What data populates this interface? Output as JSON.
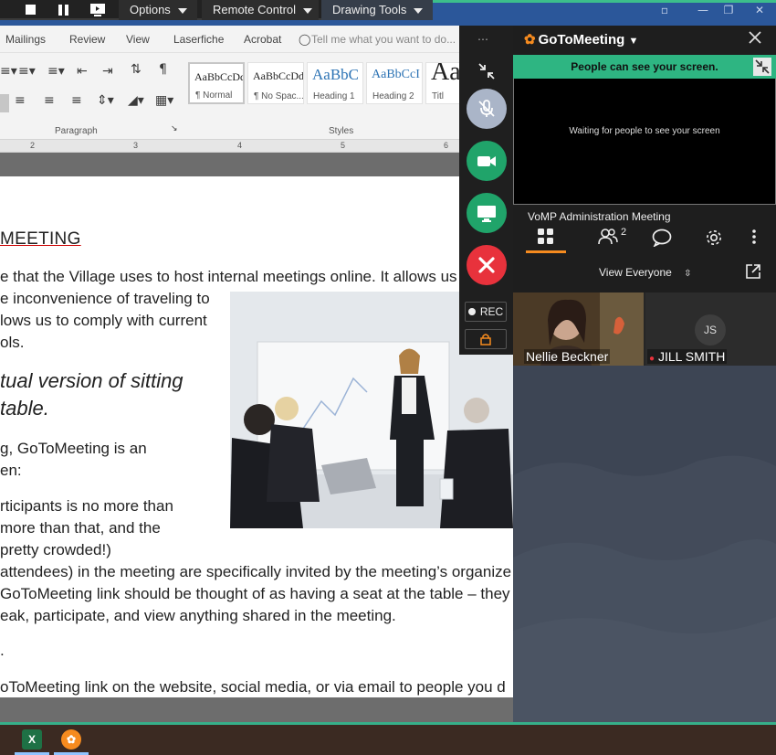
{
  "remote_bar": {
    "options_label": "Options",
    "remote_control_label": "Remote Control",
    "drawing_tools_label": "Drawing Tools"
  },
  "word": {
    "tabs": [
      "Mailings",
      "Review",
      "View",
      "Laserfiche",
      "Acrobat"
    ],
    "tell_me_placeholder": "Tell me what you want to do...",
    "paragraph_group_label": "Paragraph",
    "styles_group_label": "Styles",
    "styles": [
      {
        "sample": "AaBbCcDd",
        "name": "¶ Normal"
      },
      {
        "sample": "AaBbCcDd",
        "name": "¶ No Spac..."
      },
      {
        "sample": "AaBbC",
        "name": "Heading 1"
      },
      {
        "sample": "AaBbCcI",
        "name": "Heading 2"
      },
      {
        "sample": "Aa",
        "name": "Titl"
      }
    ],
    "ruler_numbers": [
      "2",
      "3",
      "4",
      "5",
      "6"
    ],
    "doc_lines": [
      "MEETING",
      "e that the Village uses to host internal meetings online. It allows us",
      "e inconvenience of traveling to",
      "lows us to comply with current",
      "ols.",
      "tual version of sitting",
      " table.",
      "g, GoToMeeting is an",
      "en:",
      "rticipants is no more than",
      "more than that, and the",
      " pretty crowded!)",
      "attendees) in the meeting are specifically invited by the meeting’s organize",
      "GoToMeeting link should be thought of as having a seat at the table – they",
      "eak, participate, and view anything shared in the meeting.",
      ".",
      "oToMeeting link on the website, social media, or via email to people you d"
    ]
  },
  "g2m": {
    "app_name": "GoToMeeting",
    "sharing_banner": "People can see your screen.",
    "waiting_text": "Waiting for people to see your screen",
    "meeting_name": "VoMP Administration Meeting",
    "attendee_count": "2",
    "view_label": "View Everyone",
    "rec_label": "REC",
    "participants": [
      {
        "name": "Nellie Beckner"
      },
      {
        "name": "JILL SMITH",
        "initials": "JS"
      }
    ]
  },
  "colors": {
    "green": "#2eb582",
    "orange": "#f68b1f",
    "red": "#e8323c",
    "word_blue": "#2b579a"
  }
}
